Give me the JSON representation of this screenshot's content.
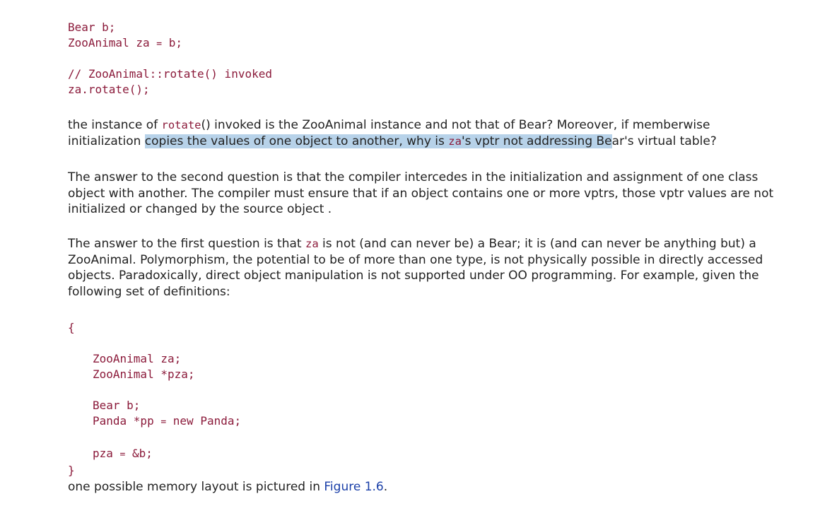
{
  "code_block_1": {
    "line1": "Bear b;",
    "line2_a": "ZooAnimal za ",
    "line2_op": "=",
    "line2_b": " b;"
  },
  "code_block_2": {
    "comment": "// ZooAnimal::rotate() invoked",
    "call": "za.rotate();"
  },
  "paragraph_1": {
    "t1": "the instance of ",
    "c1": "rotate",
    "t2": "() invoked is the ZooAnimal instance and not that of Bear? Moreover, if memberwise initialization ",
    "h1": "copies the values of one object to another, why is ",
    "h_code": "za",
    "h2": "'s vptr not addressing Be",
    "t3": "ar's virtual table?"
  },
  "paragraph_2": {
    "text": "The answer to the second question is that the compiler intercedes in the initialization and assignment of one class object with another. The compiler must ensure that if an object contains one or more vptrs, those vptr values are not initialized or changed by the source object ."
  },
  "paragraph_3": {
    "t1": "The answer to the first question is that ",
    "c1": "za",
    "t2": " is not (and can never be) a Bear; it is (and can never be anything but) a ZooAnimal. Polymorphism, the potential to be of more than one type, is not physically possible in directly accessed objects. Paradoxically, direct object manipulation is not supported under OO programming. For example, given the following set of definitions:"
  },
  "code_block_3": {
    "open_brace": "{",
    "l1": "ZooAnimal za;",
    "l2": "ZooAnimal *pza;",
    "l3": "Bear b;",
    "l4_a": "Panda *pp ",
    "l4_op": "=",
    "l4_b": " new Panda;",
    "l5_a": "pza ",
    "l5_op": "=",
    "l5_b": " &b;",
    "close_brace": "}"
  },
  "paragraph_4": {
    "t1": "one possible memory layout is pictured in ",
    "link": "Figure 1.6",
    "t2": "."
  }
}
